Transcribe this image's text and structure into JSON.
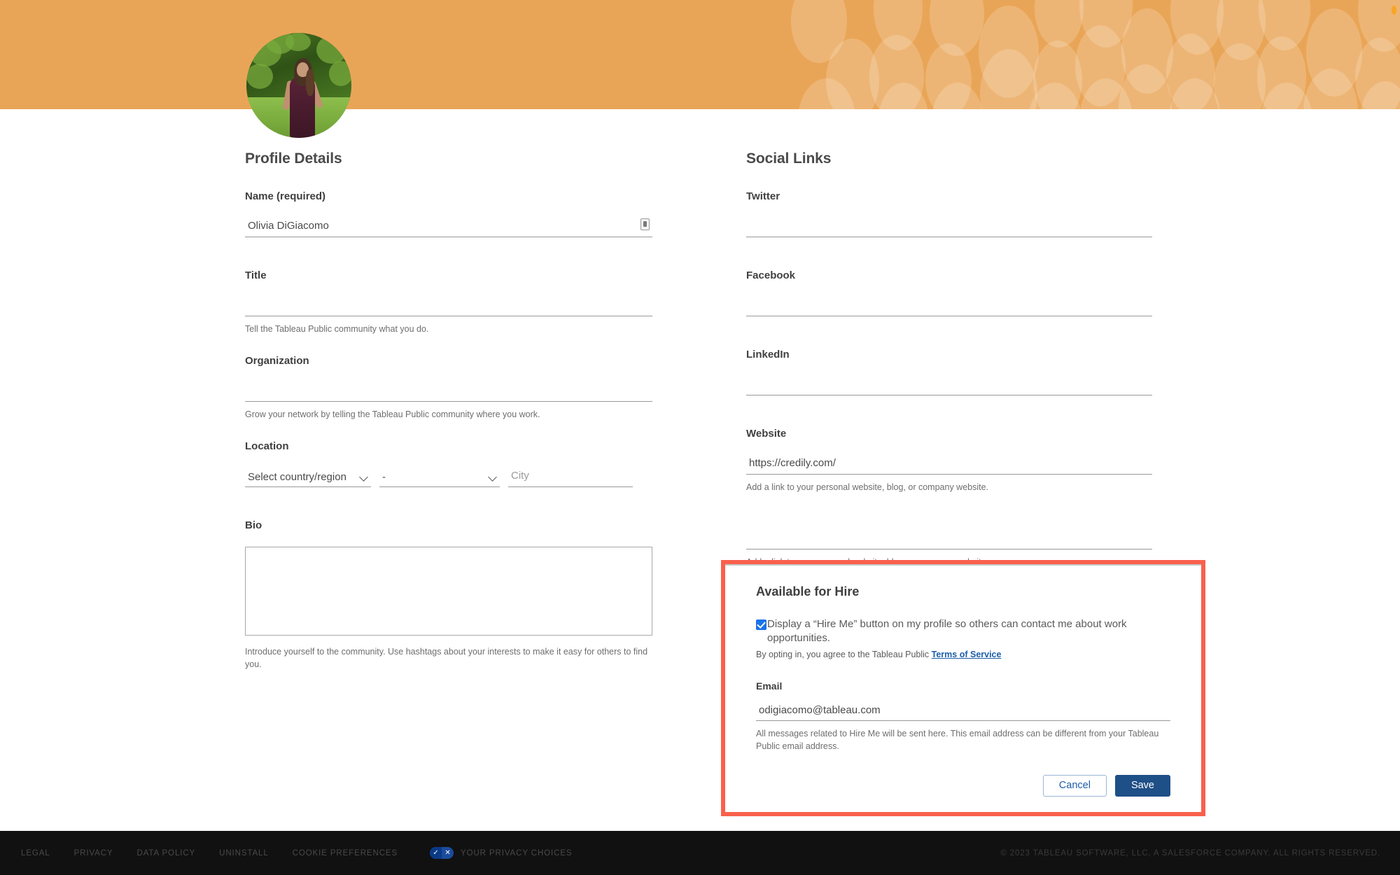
{
  "banner": {
    "background_color": "#e9a557",
    "pattern_color": "#f2bd7d",
    "accent_dot_color": "#f9a524"
  },
  "avatar": {
    "alt": "profile photo of a woman standing on grass in front of green foliage"
  },
  "profile_details": {
    "section_title": "Profile Details",
    "name": {
      "label": "Name (required)",
      "value": "Olivia DiGiacomo",
      "placeholder": ""
    },
    "title": {
      "label": "Title",
      "value": "",
      "placeholder": "",
      "helper": "Tell the Tableau Public community what you do."
    },
    "organization": {
      "label": "Organization",
      "value": "",
      "placeholder": "",
      "helper": "Grow your network by telling the Tableau Public community where you work."
    },
    "location": {
      "label": "Location",
      "country": "Select country/region",
      "state": "-",
      "city_value": "",
      "city_placeholder": "City"
    },
    "bio": {
      "label": "Bio",
      "value": "",
      "helper": "Introduce yourself to the community. Use hashtags about your interests to make it easy for others to find you."
    }
  },
  "social_links": {
    "section_title": "Social Links",
    "fields": [
      {
        "label": "Twitter",
        "value": "",
        "helper": ""
      },
      {
        "label": "Facebook",
        "value": "",
        "helper": ""
      },
      {
        "label": "LinkedIn",
        "value": "",
        "helper": ""
      },
      {
        "label": "Website",
        "value": "https://credily.com/",
        "helper": "Add a link to your personal website, blog, or company website."
      },
      {
        "label": "",
        "value": "",
        "helper": "Add a link to your personal website, blog, or company website."
      }
    ]
  },
  "available_for_hire": {
    "title": "Available for Hire",
    "checkbox_checked": true,
    "checkbox_label": "Display a “Hire Me” button on my profile so others can contact me about work opportunities.",
    "tos_prefix": "By opting in, you agree to the Tableau Public ",
    "tos_link": "Terms of Service",
    "email_label": "Email",
    "email_value": "odigiacomo@tableau.com",
    "email_helper": "All messages related to Hire Me will be sent here. This email address can be different from your Tableau Public email address.",
    "cancel_label": "Cancel",
    "save_label": "Save",
    "highlight_color": "#f9604c",
    "save_color": "#1f4f87",
    "link_color": "#1c5ea8",
    "checkbox_color": "#1a73e8"
  },
  "footer": {
    "links": [
      "LEGAL",
      "PRIVACY",
      "DATA POLICY",
      "UNINSTALL",
      "COOKIE PREFERENCES"
    ],
    "privacy_choices_label": "YOUR PRIVACY CHOICES",
    "privacy_icon_check": "✓",
    "privacy_icon_x": "✕",
    "copyright": "© 2023 TABLEAU SOFTWARE, LLC, A SALESFORCE COMPANY. ALL RIGHTS RESERVED."
  }
}
